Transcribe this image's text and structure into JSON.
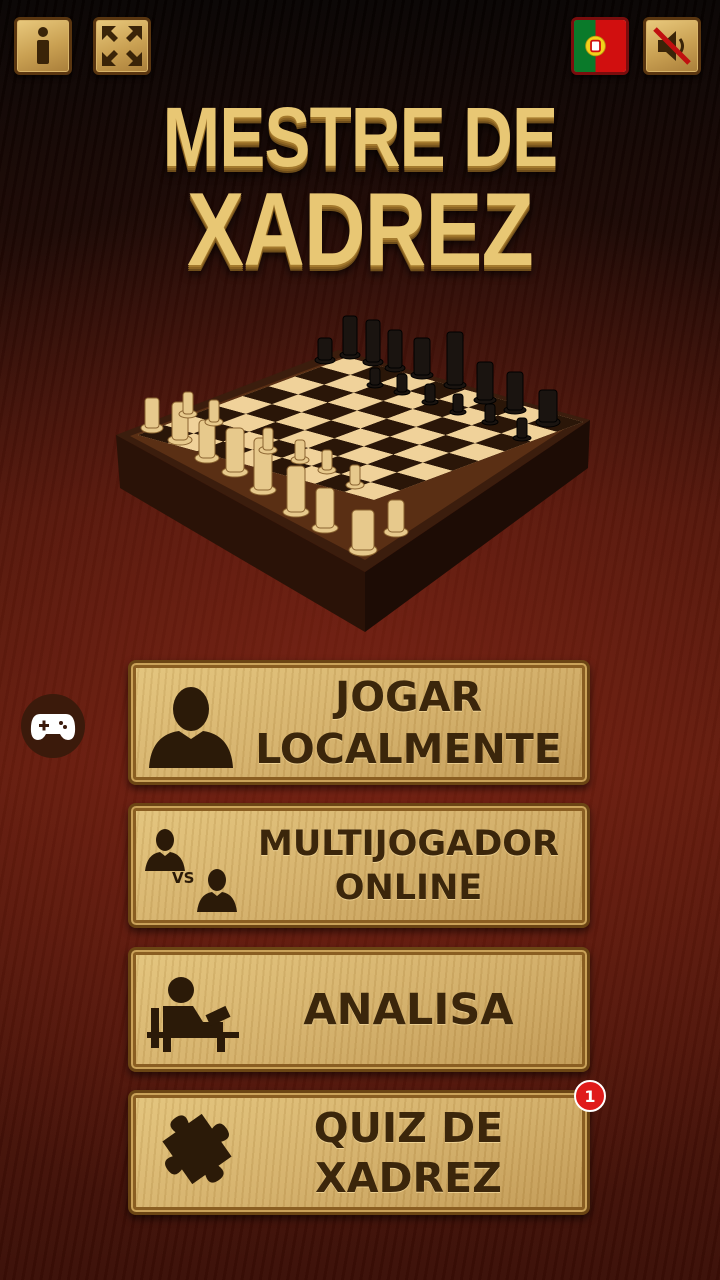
{
  "header": {
    "info_icon": "info-icon",
    "fullscreen_icon": "fullscreen-icon",
    "language_flag": "portugal-flag-icon",
    "sound_icon": "sound-muted-icon"
  },
  "title": {
    "line1": "MESTRE DE",
    "line2": "XADREZ"
  },
  "menu": {
    "play_local": {
      "line1": "JOGAR",
      "line2": "LOCALMENTE"
    },
    "multiplayer": {
      "line1": "MULTIJOGADOR",
      "line2": "ONLINE",
      "vs_label": "VS"
    },
    "analyze": {
      "label": "ANALISA"
    },
    "quiz": {
      "line1": "QUIZ DE",
      "line2": "XADREZ",
      "badge": "1"
    }
  },
  "colors": {
    "gold": "#e8c774",
    "button_wood": "#d4b06a",
    "label_brown": "#3b260b",
    "badge_red": "#e01b1b"
  }
}
